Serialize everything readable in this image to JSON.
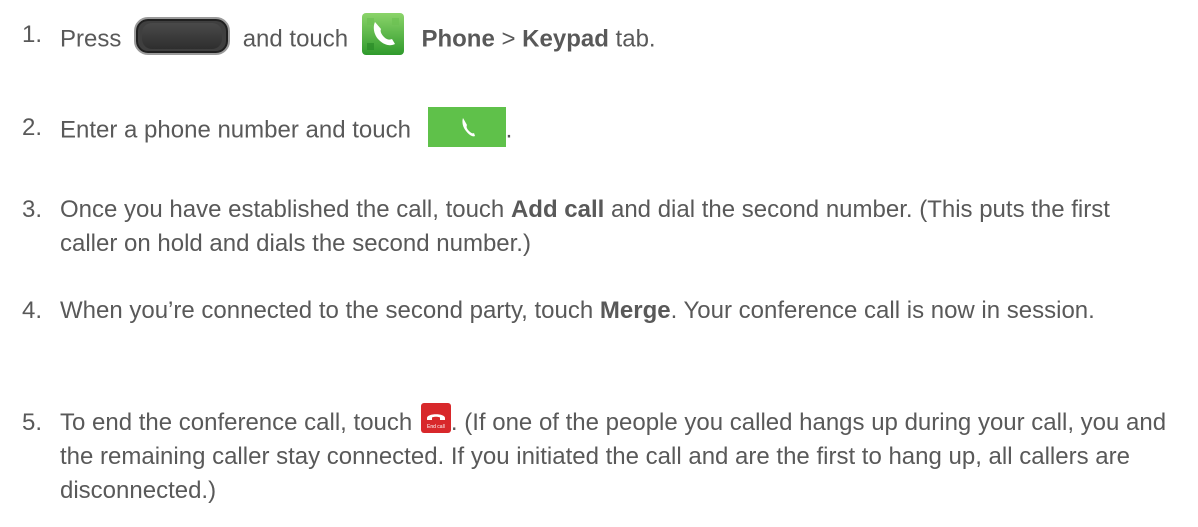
{
  "steps": [
    {
      "num": "1.",
      "t1": "Press",
      "t2": "and touch",
      "b1": "Phone",
      "t3": ">",
      "b2": "Keypad",
      "t4": "tab."
    },
    {
      "num": "2.",
      "t1": "Enter a phone number and touch",
      "t2": "."
    },
    {
      "num": "3.",
      "t1": "Once you have established the call, touch",
      "b1": "Add call",
      "t2": "and dial the second number. (This puts the first caller on hold and dials the second number.)"
    },
    {
      "num": "4.",
      "t1": "When you’re connected to the second party, touch",
      "b1": "Merge",
      "t2": ". Your conference call is now in session."
    },
    {
      "num": "5.",
      "t1": "To end the conference call, touch",
      "end_call_label": "End call",
      "t2": ". (If one of the people you called hangs up during your call, you and the remaining caller stay connected. If you initiated the call and are the first to hang up, all callers are disconnected.)"
    }
  ],
  "icons": {
    "home_key": "home-key-icon",
    "phone_app": "phone-app-icon",
    "call_button": "call-button-icon",
    "end_call": "end-call-icon"
  },
  "colors": {
    "text": "#595959",
    "call_green": "#5fc14a",
    "end_call_red": "#d8282b"
  }
}
